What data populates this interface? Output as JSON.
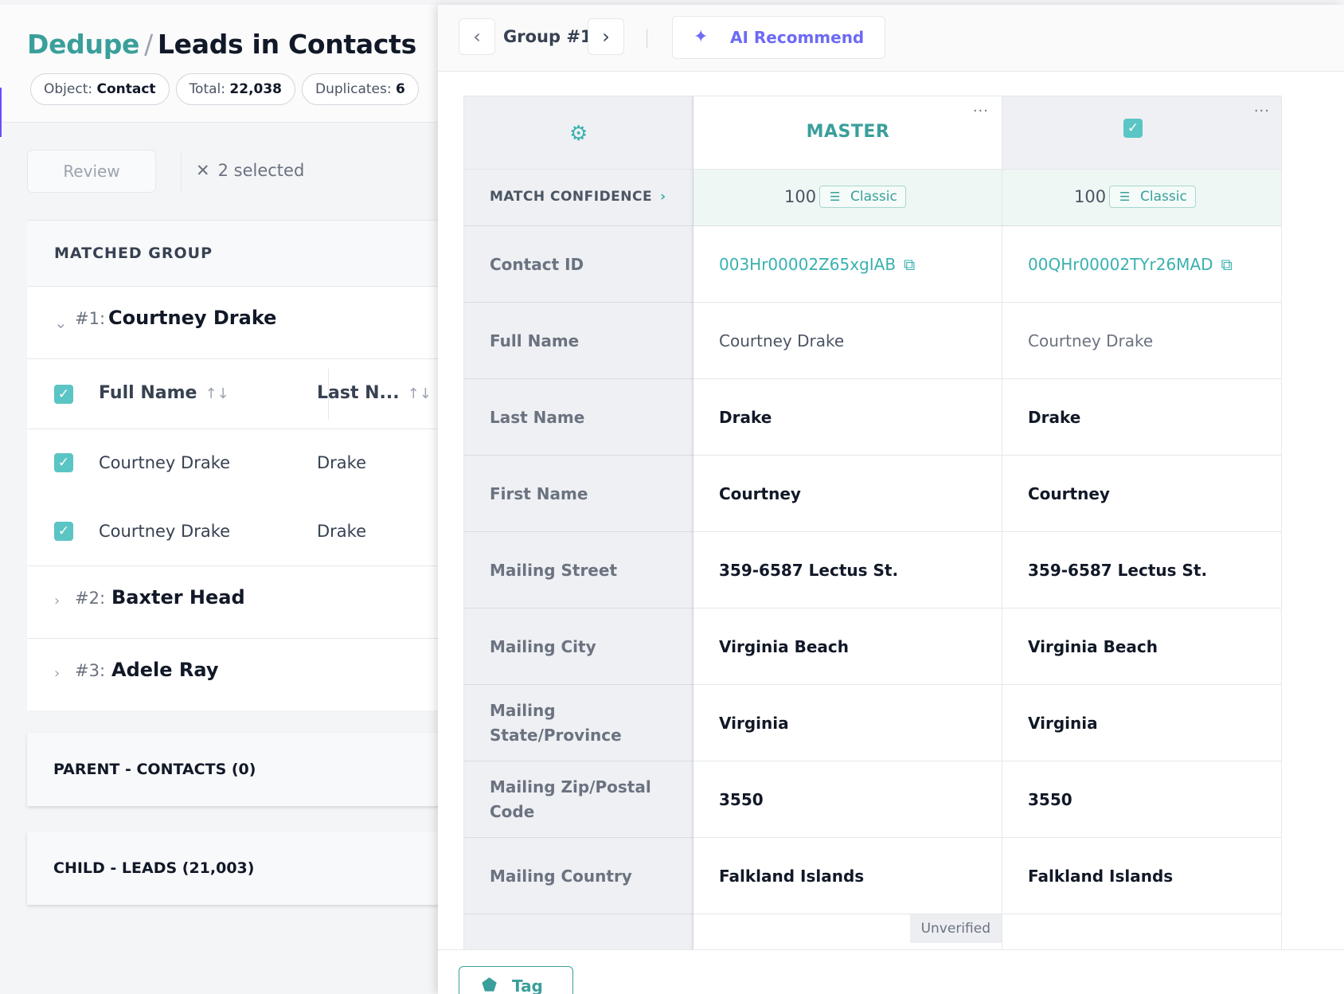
{
  "page": {
    "title_part1": "Dedupe",
    "title_sep": "/",
    "title_part2": "Leads in Contacts",
    "chips": [
      {
        "label": "Object:",
        "value": "Contact"
      },
      {
        "label": "Total:",
        "value": "22,038"
      },
      {
        "label": "Duplicates:",
        "value": "6"
      }
    ]
  },
  "toolbar": {
    "review_label": "Review",
    "selected_label": "2 selected"
  },
  "matched": {
    "header": "MATCHED GROUP",
    "groups": [
      {
        "num": "#1:",
        "name": "Courtney Drake"
      },
      {
        "num": "#2:",
        "name": "Baxter Head"
      },
      {
        "num": "#3:",
        "name": "Adele Ray"
      }
    ],
    "columns": [
      "Full Name",
      "Last N..."
    ],
    "rows": [
      {
        "full_name": "Courtney Drake",
        "last_name": "Drake"
      },
      {
        "full_name": "Courtney Drake",
        "last_name": "Drake"
      }
    ]
  },
  "sections": {
    "parent": "PARENT - CONTACTS (0)",
    "child": "CHILD - LEADS (21,003)"
  },
  "drawer": {
    "group_label": "Group #1",
    "ai_label": "AI Recommend",
    "master_label": "MASTER",
    "dots": "···",
    "match_conf_label": "MATCH CONFIDENCE",
    "master_conf": "100",
    "dup_conf": "100",
    "classic_label": "Classic",
    "unverified_label": "Unverified",
    "tag_label": "Tag",
    "fields": [
      {
        "label": "Contact ID",
        "master": "003Hr00002Z65xgIAB",
        "dup": "00QHr00002TYr26MAD"
      },
      {
        "label": "Full Name",
        "master": "Courtney Drake",
        "dup": "Courtney Drake"
      },
      {
        "label": "Last Name",
        "master": "Drake",
        "dup": "Drake"
      },
      {
        "label": "First Name",
        "master": "Courtney",
        "dup": "Courtney"
      },
      {
        "label": "Mailing Street",
        "master": "359-6587 Lectus St.",
        "dup": "359-6587 Lectus St."
      },
      {
        "label": "Mailing City",
        "master": "Virginia Beach",
        "dup": "Virginia Beach"
      },
      {
        "label": "Mailing State/Province",
        "master": "Virginia",
        "dup": "Virginia"
      },
      {
        "label": "Mailing Zip/Postal Code",
        "master": "3550",
        "dup": "3550"
      },
      {
        "label": "Mailing Country",
        "master": "Falkland Islands",
        "dup": "Falkland Islands"
      }
    ]
  },
  "colors": {
    "teal": "#3a9f9b",
    "checkbox": "#5bc4c4",
    "ai_purple": "#6d6af5"
  }
}
